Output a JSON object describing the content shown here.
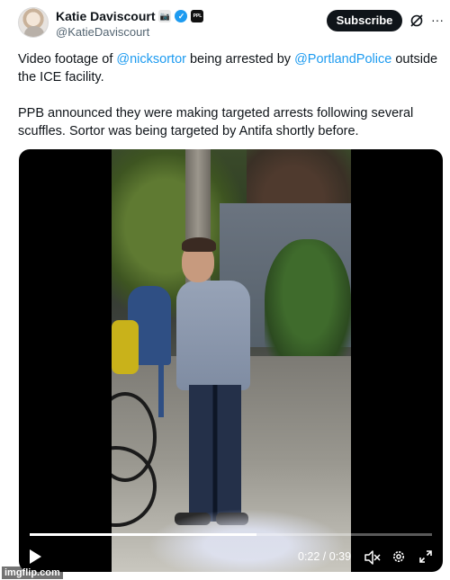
{
  "author": {
    "display_name": "Katie Daviscourt",
    "handle": "@KatieDaviscourt",
    "badge_icons": [
      "camera-icon",
      "verified-badge-icon",
      "org-affiliate-icon"
    ],
    "org_badge_text": "PPL"
  },
  "header": {
    "subscribe_label": "Subscribe"
  },
  "tweet": {
    "p1_prefix": "Video footage of ",
    "mention1": "@nicksortor",
    "p1_middle": " being arrested by ",
    "mention2": "@PortlandPolice",
    "p1_suffix": " outside the ICE facility.",
    "p2": "PPB announced they were making targeted arrests following several scuffles. Sortor was being targeted by Antifa shortly before."
  },
  "video": {
    "current_time": "0:22",
    "duration": "0:39",
    "time_display": "0:22 / 0:39",
    "progress_fraction": 0.564
  },
  "colors": {
    "accent": "#1d9bf0",
    "subscribe_bg": "#0f1419",
    "handle_gray": "#536471"
  },
  "watermark": "imgflip.com"
}
